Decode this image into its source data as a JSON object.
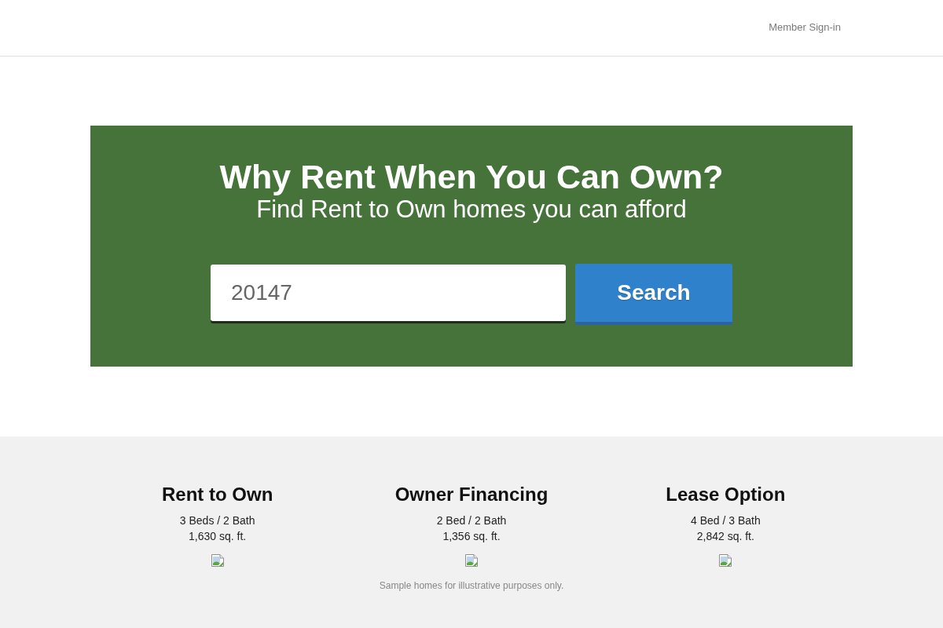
{
  "header": {
    "sign_in_link": "Member Sign-in"
  },
  "hero": {
    "title": "Why Rent When You Can Own?",
    "subtitle": "Find Rent to Own homes you can afford",
    "search": {
      "value": "20147",
      "button": "Search"
    }
  },
  "listings": [
    {
      "title": "Rent to Own",
      "rooms": "3 Beds / 2 Bath",
      "area": "1,630 sq. ft."
    },
    {
      "title": "Owner Financing",
      "rooms": "2 Bed / 2 Bath",
      "area": "1,356 sq. ft."
    },
    {
      "title": "Lease Option",
      "rooms": "4 Bed / 3 Bath",
      "area": "2,842 sq. ft."
    }
  ],
  "disclaimer": "Sample homes for illustrative purposes only."
}
